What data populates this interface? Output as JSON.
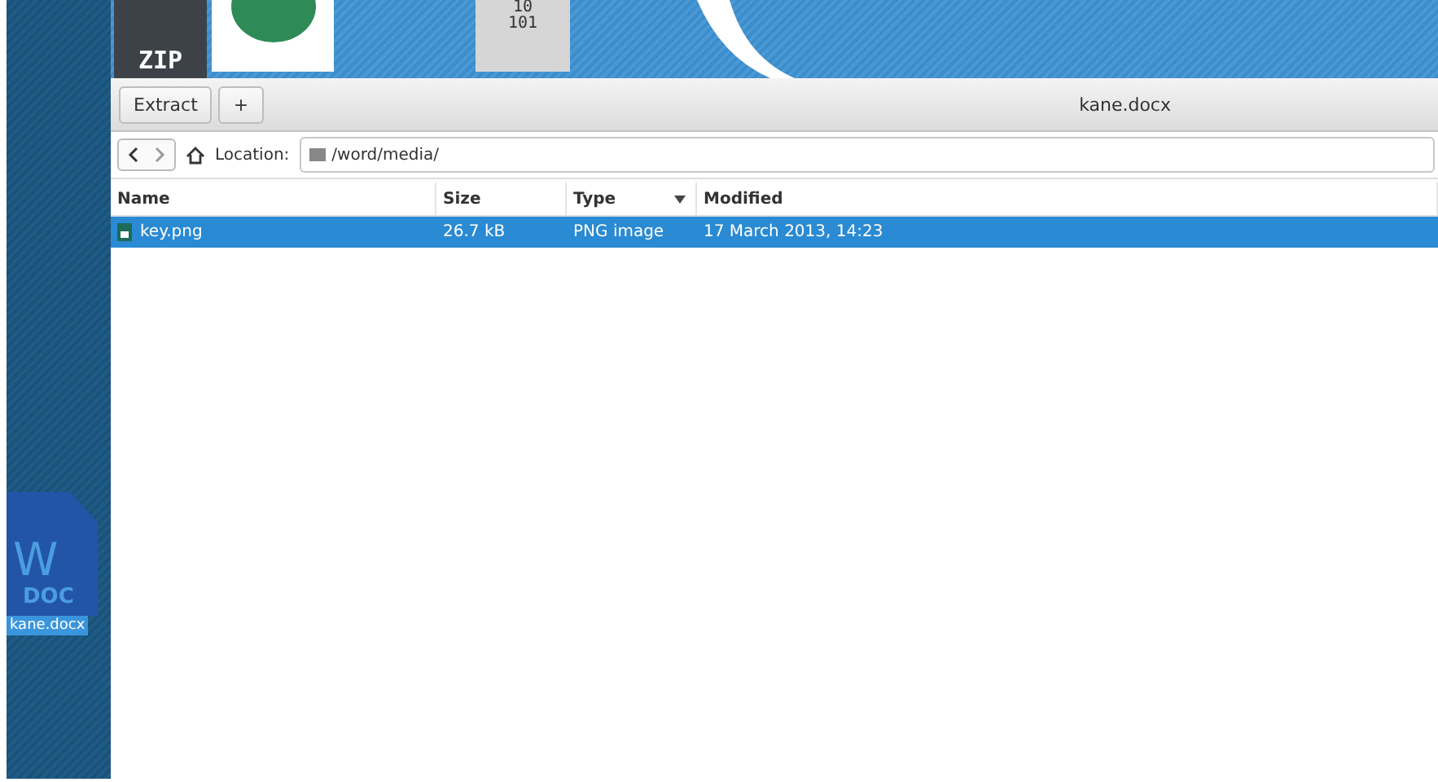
{
  "desktop": {
    "top_icons": [
      {
        "kind": "zip",
        "caption": "ZIP"
      },
      {
        "kind": "picture"
      },
      {
        "kind": "binary",
        "lines": [
          "10",
          "101"
        ]
      }
    ],
    "file_icon": {
      "letter": "W",
      "type_label": "DOC",
      "caption": "kane.docx",
      "selected": true
    }
  },
  "window": {
    "title": "kane.docx",
    "toolbar": {
      "buttons": [
        "Extract",
        "+"
      ]
    },
    "location": {
      "label": "Location:",
      "path": "/word/media/"
    },
    "table": {
      "columns": [
        {
          "label": "Name",
          "sorted": false
        },
        {
          "label": "Size",
          "sorted": false
        },
        {
          "label": "Type",
          "sorted": true
        },
        {
          "label": "Modified",
          "sorted": false
        }
      ],
      "rows": [
        {
          "cells": [
            "key.png",
            "26.7 kB",
            "PNG image",
            "17 March 2013, 14:23"
          ],
          "selected": true
        }
      ]
    }
  }
}
